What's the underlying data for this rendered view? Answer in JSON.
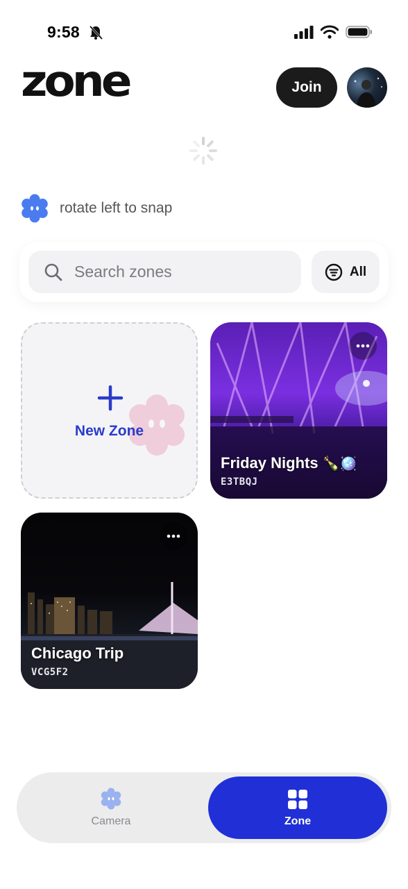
{
  "status_bar": {
    "time": "9:58"
  },
  "header": {
    "logo": "zone",
    "join_label": "Join"
  },
  "hint": {
    "text": "rotate left to snap"
  },
  "search": {
    "placeholder": "Search zones",
    "filter_label": "All"
  },
  "new_zone": {
    "label": "New Zone"
  },
  "zones": [
    {
      "title": "Friday Nights",
      "emoji": "🍾🪩",
      "code": "E3TBQJ"
    },
    {
      "title": "Chicago Trip",
      "code": "VCG5F2"
    }
  ],
  "bottom_nav": {
    "camera_label": "Camera",
    "zone_label": "Zone"
  },
  "colors": {
    "accent": "#2030d6",
    "link": "#2a3bc9",
    "hint_icon": "#4a7cf0"
  },
  "icons": [
    "bell-off-icon",
    "signal-icon",
    "wifi-icon",
    "battery-icon",
    "loading-spinner-icon",
    "flower-snap-icon",
    "search-icon",
    "filter-icon",
    "plus-icon",
    "more-icon",
    "grid-icon"
  ]
}
